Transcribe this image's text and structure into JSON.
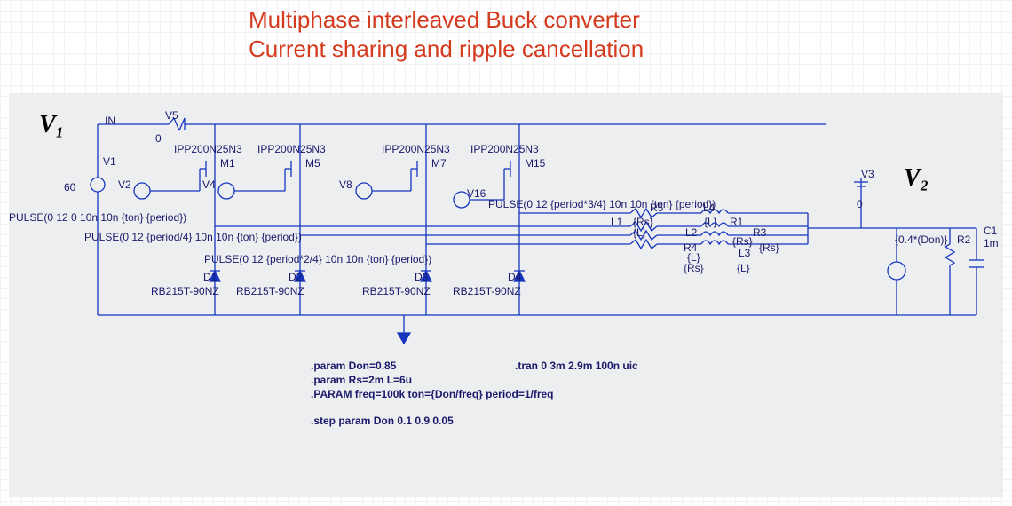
{
  "title_line1": "Multiphase interleaved Buck converter",
  "title_line2": "Current sharing and ripple cancellation",
  "hand": {
    "v1": "V₁",
    "v2": "V₂"
  },
  "nodes": {
    "in": "IN",
    "zero1": "0",
    "zero2": "0"
  },
  "sources": {
    "v1": "V1",
    "v1_val": "60",
    "v2": "V2",
    "v4": "V4",
    "v5": "V5",
    "v8": "V8",
    "v16": "V16",
    "v3": "V3"
  },
  "mosfet_model": "IPP200N25N3",
  "fets": {
    "m1": "M1",
    "m5": "M5",
    "m7": "M7",
    "m15": "M15"
  },
  "diode_model": "RB215T-90NZ",
  "diodes": {
    "d1": "D1",
    "d2": "D2",
    "d3": "D3",
    "d4": "D4"
  },
  "pulses": {
    "p1": "PULSE(0 12 0 10n 10n {ton} {period})",
    "p2": "PULSE(0 12 {period/4} 10n 10n {ton} {period})",
    "p3": "PULSE(0 12 {period*2/4} 10n 10n {ton} {period})",
    "p4": "PULSE(0 12 {period*3/4} 10n 10n {ton} {period})"
  },
  "rl": {
    "L1": "L1",
    "L2": "L2",
    "L3": "L3",
    "L4": "L4",
    "R1": "R1",
    "R3": "R3",
    "R4": "R4",
    "R5": "R5",
    "Rs": "{Rs}",
    "L": "{L}"
  },
  "load": {
    "ilabel": "{0.4*(Don)}",
    "r2": "R2",
    "c1": "C1",
    "c1v": "1m"
  },
  "spice": {
    "l1": ".param Don=0.85",
    "l2": ".param Rs=2m  L=6u",
    "l3": ".PARAM freq=100k  ton={Don/freq}  period=1/freq",
    "l4": ".step param Don 0.1 0.9 0.05",
    "l5": ".tran 0 3m 2.9m 100n uic"
  }
}
